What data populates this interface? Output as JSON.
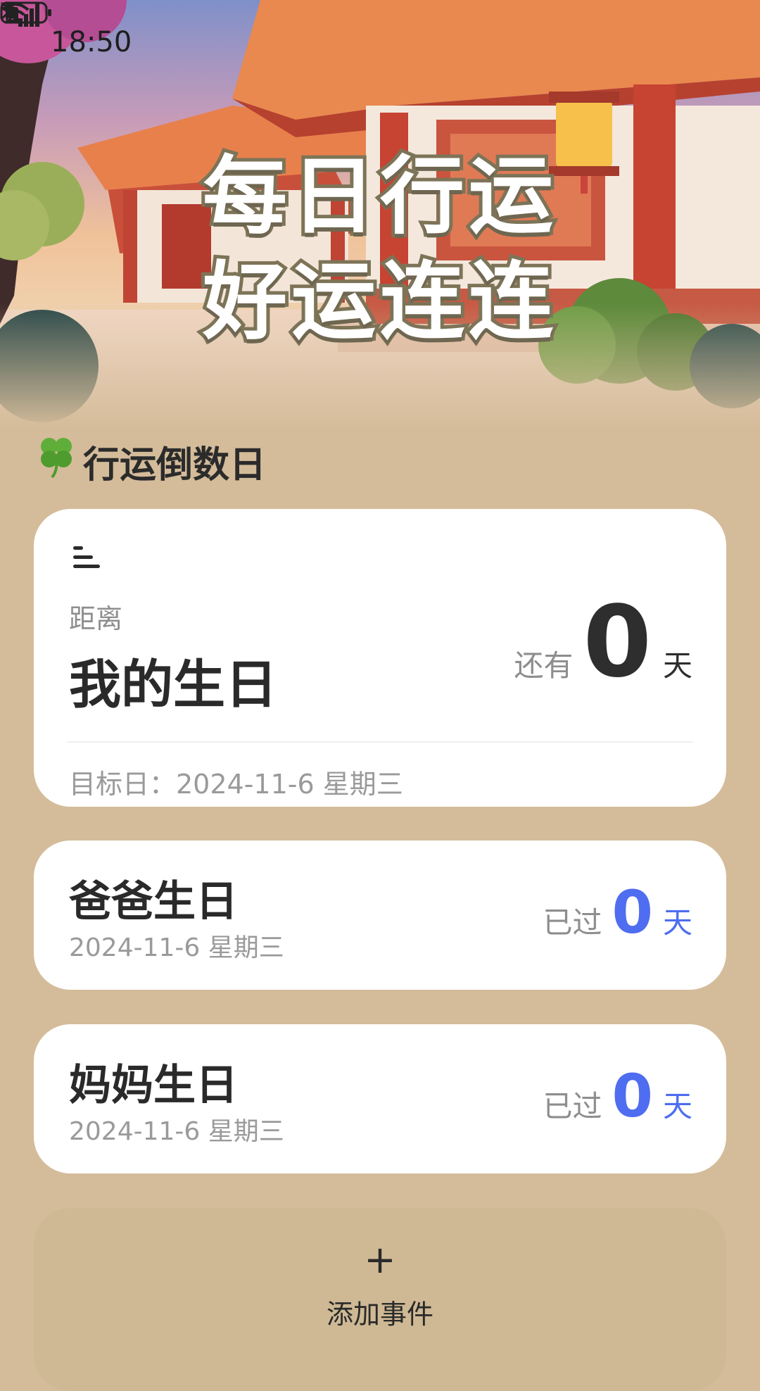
{
  "status_bar": {
    "time": "18:50",
    "icons": [
      "bluetooth-icon",
      "mute-icon",
      "wifi-icon",
      "5g-signal-icon",
      "battery-icon"
    ],
    "network_label": "5G"
  },
  "hero": {
    "title_line1": "每日行运",
    "title_line2": "好运连连"
  },
  "section": {
    "icon": "clover-icon",
    "title": "行运倒数日"
  },
  "main_card": {
    "menu_icon": "menu-icon",
    "label": "距离",
    "event_name": "我的生日",
    "days_prefix": "还有",
    "days_value": "0",
    "days_unit": "天",
    "target_date": "目标日：2024-11-6 星期三"
  },
  "events": [
    {
      "name": "爸爸生日",
      "date": "2024-11-6 星期三",
      "prefix": "已过",
      "value": "0",
      "unit": "天"
    },
    {
      "name": "妈妈生日",
      "date": "2024-11-6 星期三",
      "prefix": "已过",
      "value": "0",
      "unit": "天"
    }
  ],
  "add_event": {
    "icon": "+",
    "label": "添加事件"
  },
  "colors": {
    "page_background": "#d4bc9a",
    "accent_blue": "#4f6df0",
    "title_outline": "#7d7458"
  }
}
